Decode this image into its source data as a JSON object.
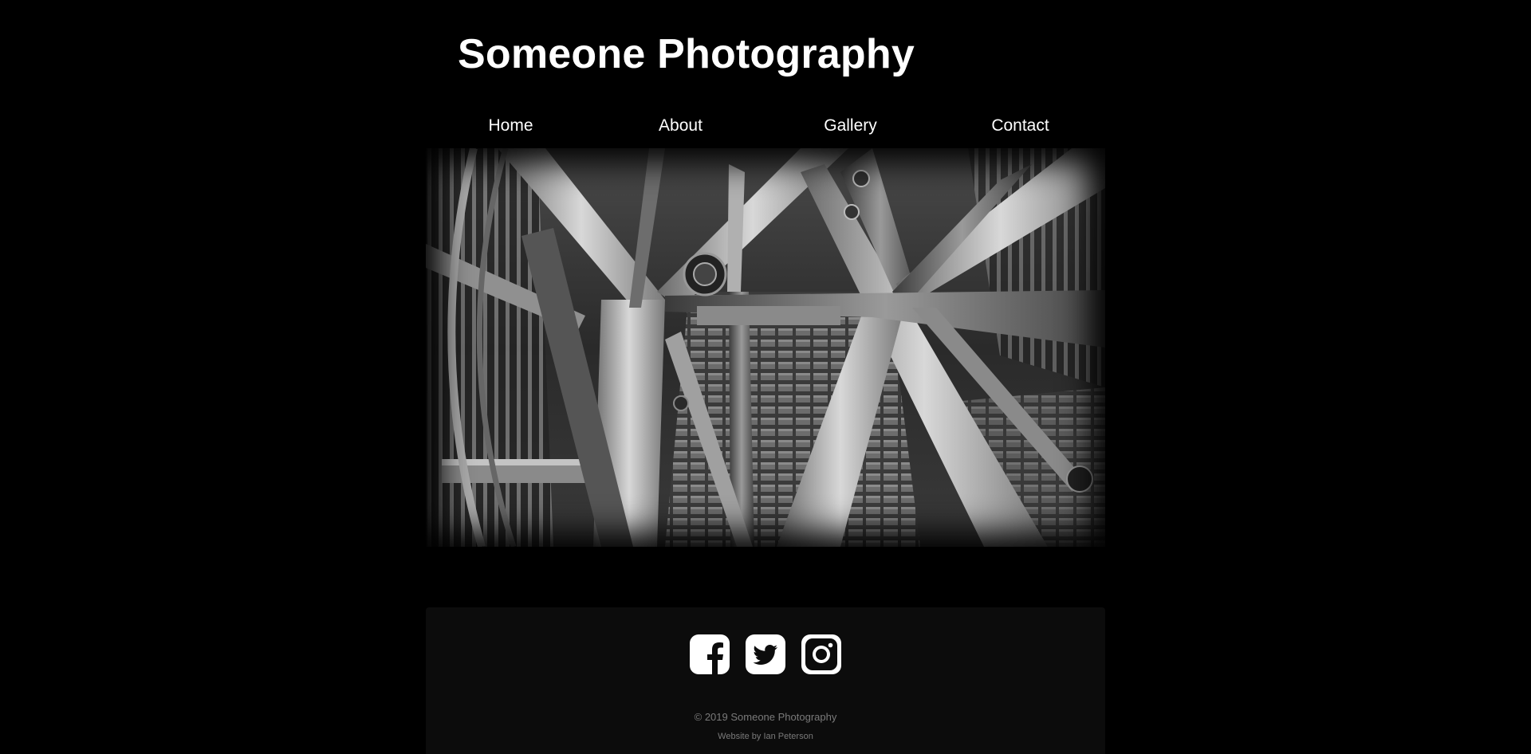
{
  "header": {
    "site_title": "Someone Photography"
  },
  "nav": {
    "items": [
      {
        "label": "Home"
      },
      {
        "label": "About"
      },
      {
        "label": "Gallery"
      },
      {
        "label": "Contact"
      }
    ]
  },
  "hero": {
    "image": "black-and-white steel lattice structure photograph"
  },
  "footer": {
    "social": [
      {
        "icon": "facebook-icon"
      },
      {
        "icon": "twitter-icon"
      },
      {
        "icon": "instagram-icon"
      }
    ],
    "copyright": "© 2019 Someone Photography",
    "credit": "Website by Ian Peterson"
  },
  "colors": {
    "background": "#000000",
    "footer_background": "#0c0c0c",
    "text": "#ffffff",
    "muted_text": "#7a7a7a"
  }
}
